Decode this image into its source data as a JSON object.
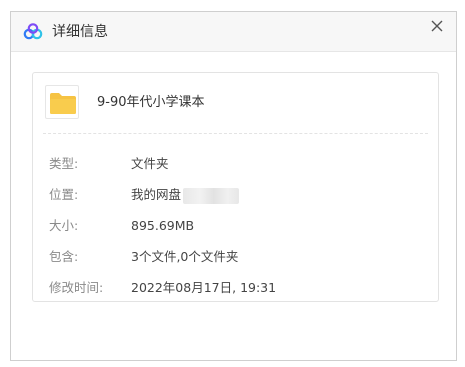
{
  "window": {
    "title": "详细信息",
    "close_glyph": "✕"
  },
  "file": {
    "name": "9-90年代小学课本",
    "icon": "folder-icon"
  },
  "details": [
    {
      "key": "类型:",
      "value": "文件夹"
    },
    {
      "key": "位置:",
      "value": "我的网盘"
    },
    {
      "key": "大小:",
      "value": "895.69MB"
    },
    {
      "key": "包含:",
      "value": "3个文件,0个文件夹"
    },
    {
      "key": "修改时间:",
      "value": "2022年08月17日, 19:31"
    }
  ],
  "colors": {
    "folder": "#f6c343",
    "logo_blue": "#2f7bf5",
    "logo_purple": "#7e4cf6",
    "logo_cyan": "#2fc2e8"
  }
}
